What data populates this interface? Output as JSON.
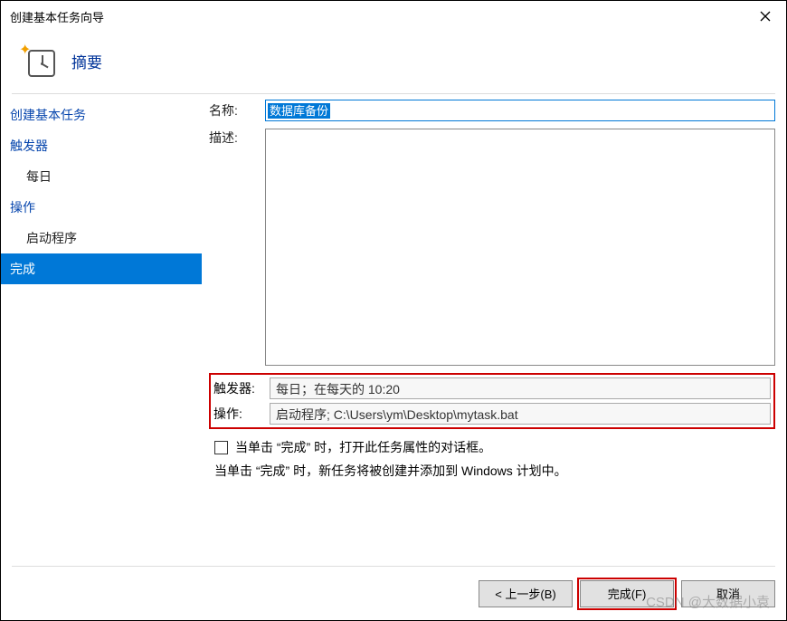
{
  "titlebar": {
    "title": "创建基本任务向导"
  },
  "header": {
    "title": "摘要"
  },
  "sidebar": {
    "items": [
      {
        "label": "创建基本任务",
        "type": "link"
      },
      {
        "label": "触发器",
        "type": "link"
      },
      {
        "label": "每日",
        "type": "sub-plain"
      },
      {
        "label": "操作",
        "type": "link"
      },
      {
        "label": "启动程序",
        "type": "sub-plain"
      },
      {
        "label": "完成",
        "type": "selected"
      }
    ]
  },
  "form": {
    "name_label": "名称:",
    "name_value": "数据库备份",
    "desc_label": "描述:",
    "desc_value": ""
  },
  "summary": {
    "trigger_label": "触发器:",
    "trigger_value": "每日；在每天的 10:20",
    "action_label": "操作:",
    "action_value": "启动程序; C:\\Users\\ym\\Desktop\\mytask.bat"
  },
  "options": {
    "open_props_label": "当单击 “完成” 时，打开此任务属性的对话框。",
    "info_text": "当单击 “完成” 时，新任务将被创建并添加到 Windows 计划中。"
  },
  "footer": {
    "back": "< 上一步(B)",
    "finish": "完成(F)",
    "cancel": "取消"
  },
  "watermark": "CSDN @大数据小袁"
}
